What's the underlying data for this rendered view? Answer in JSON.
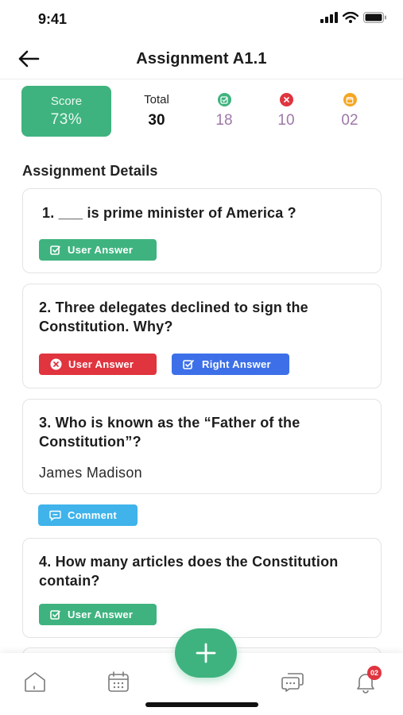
{
  "status_bar": {
    "time": "9:41"
  },
  "header": {
    "title": "Assignment A1.1"
  },
  "stats": {
    "score": {
      "label": "Score",
      "value": "73%"
    },
    "total": {
      "label": "Total",
      "value": "30"
    },
    "correct": {
      "icon": "check-square-icon",
      "value": "18",
      "color": "#3fb37f"
    },
    "wrong": {
      "icon": "x-circle-icon",
      "value": "10",
      "color": "#e0343f"
    },
    "pending": {
      "icon": "calendar-icon",
      "value": "02",
      "color": "#f5a623"
    }
  },
  "section_title": "Assignment Details",
  "questions": [
    {
      "text": "1. ___ is prime minister of America ?",
      "buttons": [
        {
          "label": "User Answer",
          "icon": "check-square-icon",
          "color": "#3fb37f"
        }
      ]
    },
    {
      "text": "2. Three delegates declined to sign the Constitution. Why?",
      "buttons": [
        {
          "label": "User Answer",
          "icon": "x-circle-icon",
          "color": "#e0343f"
        },
        {
          "label": "Right Answer",
          "icon": "check-square-icon",
          "color": "#3d70e8"
        }
      ]
    },
    {
      "text": "3. Who is known as the “Father of the Constitution”?",
      "answer": "James Madison",
      "comment_button": {
        "label": "Comment",
        "icon": "comment-icon",
        "color": "#3fb3ea"
      }
    },
    {
      "text": "4. How many articles does the Constitution contain?",
      "buttons": [
        {
          "label": "User Answer",
          "icon": "check-square-icon",
          "color": "#3fb37f"
        }
      ]
    }
  ],
  "bottom_nav": {
    "items": [
      "home-icon",
      "calendar-icon",
      "chat-icon",
      "bell-icon"
    ],
    "notification_badge": "02",
    "fab_icon": "plus-icon"
  },
  "colors": {
    "accent": "#3fb37f",
    "red": "#e0343f",
    "blue": "#3d70e8",
    "cyan": "#3fb3ea",
    "orange": "#f5a623",
    "purple_value": "#9e78a8"
  }
}
